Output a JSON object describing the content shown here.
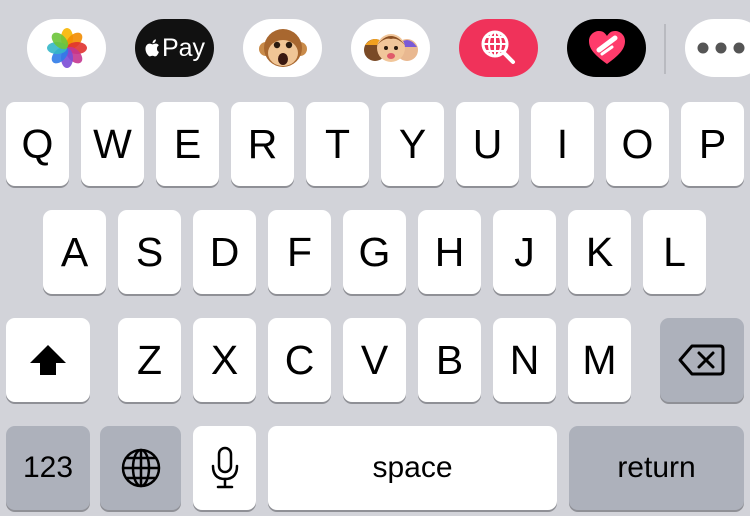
{
  "app_bar": {
    "apps": [
      {
        "id": "photos",
        "icon": "photos-icon"
      },
      {
        "id": "apple-pay",
        "icon": "apple-pay-icon",
        "label": "Pay"
      },
      {
        "id": "animoji",
        "icon": "monkey-animoji-icon"
      },
      {
        "id": "memoji",
        "icon": "memoji-stickers-icon"
      },
      {
        "id": "search-images",
        "icon": "globe-search-icon"
      },
      {
        "id": "digital-touch",
        "icon": "digital-touch-heart-icon"
      },
      {
        "id": "more",
        "icon": "more-dots-icon"
      }
    ]
  },
  "keyboard": {
    "row1": [
      "Q",
      "W",
      "E",
      "R",
      "T",
      "Y",
      "U",
      "I",
      "O",
      "P"
    ],
    "row2": [
      "A",
      "S",
      "D",
      "F",
      "G",
      "H",
      "J",
      "K",
      "L"
    ],
    "row3": [
      "Z",
      "X",
      "C",
      "V",
      "B",
      "N",
      "M"
    ],
    "shift_icon": "shift-arrow-icon",
    "delete_icon": "delete-backspace-icon",
    "numbers_label": "123",
    "globe_icon": "globe-icon",
    "mic_icon": "microphone-icon",
    "space_label": "space",
    "return_label": "return"
  },
  "colors": {
    "background": "#d2d3d9",
    "key": "#ffffff",
    "special_key": "#adb1bb",
    "key_shadow": "#8f9096",
    "apple_pay_bg": "#111111",
    "search_images_bg": "#f0325a"
  }
}
